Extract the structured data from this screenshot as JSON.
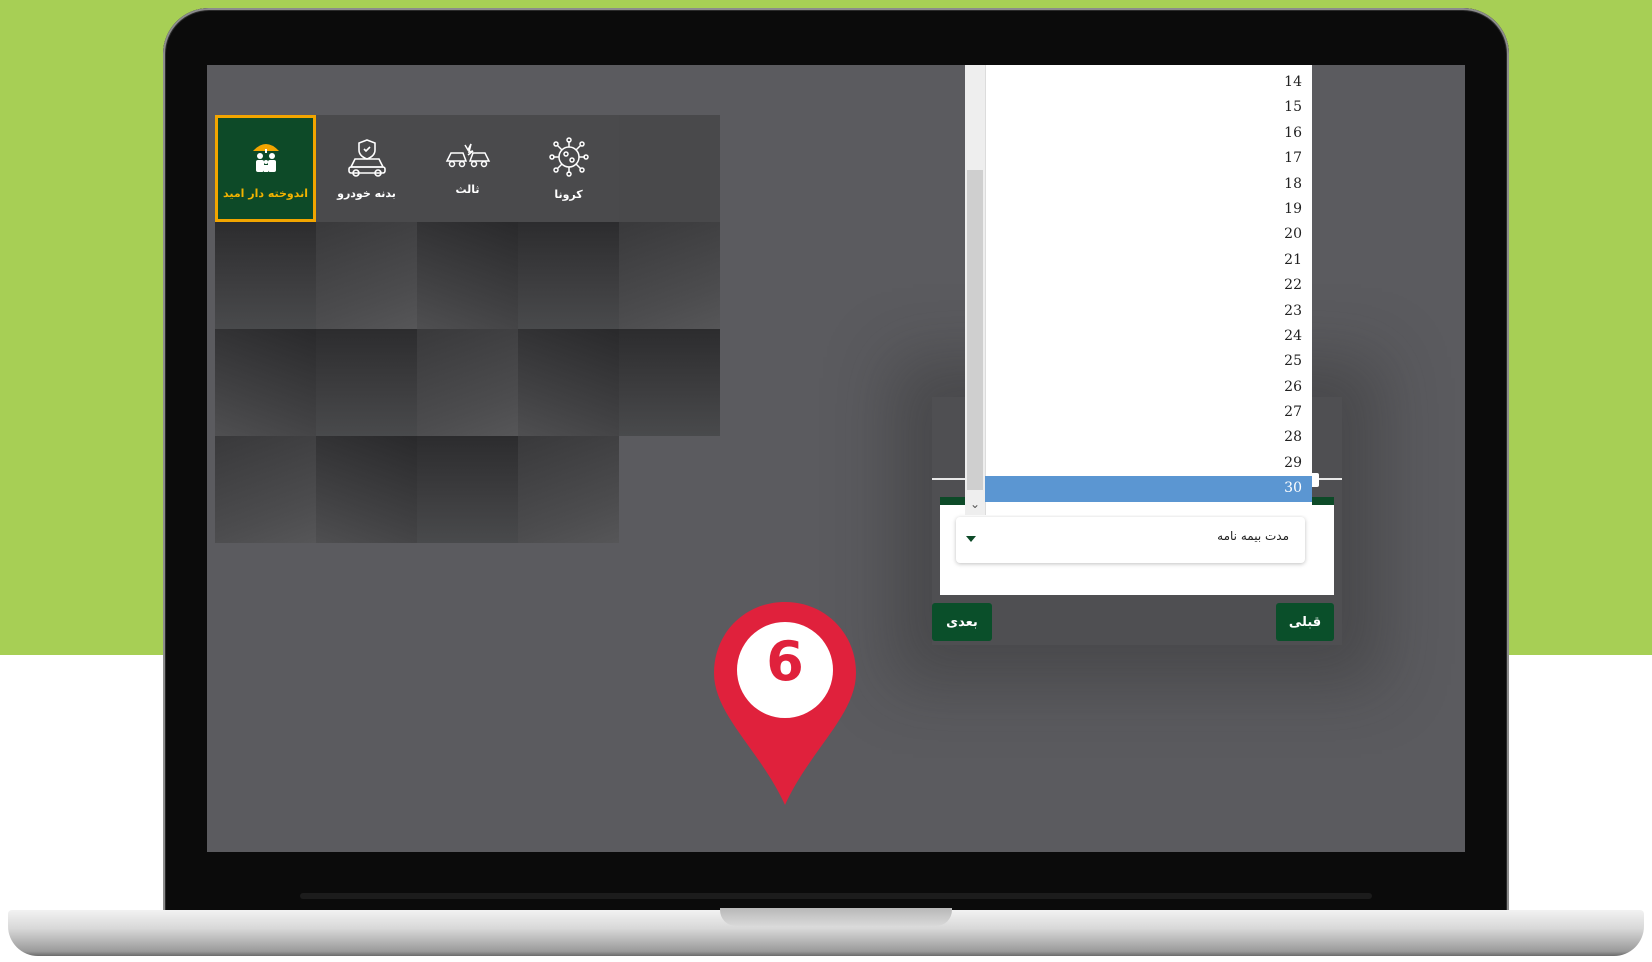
{
  "tiles": [
    {
      "label": "اندوخته دار امید",
      "icon": "family-umbrella-icon",
      "selected": true
    },
    {
      "label": "بدنه خودرو",
      "icon": "car-shield-icon",
      "selected": false
    },
    {
      "label": "ثالث",
      "icon": "car-crash-icon",
      "selected": false
    },
    {
      "label": "کرونا",
      "icon": "virus-icon",
      "selected": false
    }
  ],
  "dropdown": {
    "options": [
      "14",
      "15",
      "16",
      "17",
      "18",
      "19",
      "20",
      "21",
      "22",
      "23",
      "24",
      "25",
      "26",
      "27",
      "28",
      "29",
      "30"
    ],
    "highlighted": "30",
    "scroll_arrow": "⌄"
  },
  "form": {
    "field_label": "مدت بیمه نامه",
    "next_label": "بعدی",
    "prev_label": "قبلی"
  },
  "step_marker": {
    "number": "6"
  },
  "colors": {
    "background_green": "#a7cf55",
    "brand_green": "#0d4a28",
    "selection_border": "#f2a500",
    "highlight_blue": "#5b96d2",
    "marker_red": "#e0213c"
  }
}
